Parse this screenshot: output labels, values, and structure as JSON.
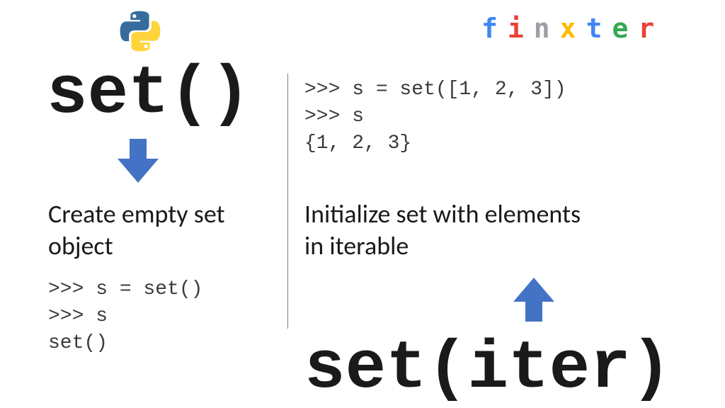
{
  "brand": {
    "letters": [
      "f",
      "i",
      "n",
      "x",
      "t",
      "e",
      "r"
    ]
  },
  "left": {
    "title": "set()",
    "description": "Create empty set object",
    "code": ">>> s = set()\n>>> s\nset()"
  },
  "right": {
    "title": "set(iter)",
    "description": "Initialize set with elements in iterable",
    "code": ">>> s = set([1, 2, 3])\n>>> s\n{1, 2, 3}"
  }
}
